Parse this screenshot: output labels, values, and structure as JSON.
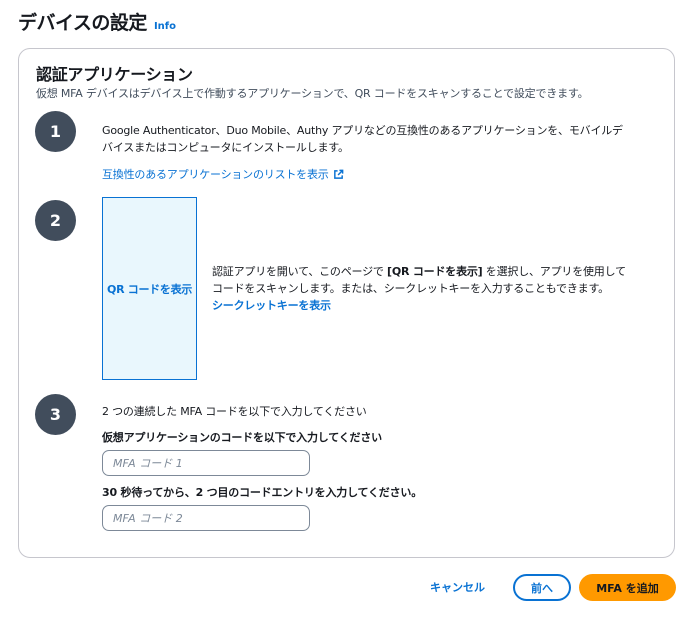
{
  "header": {
    "title": "デバイスの設定",
    "info": "Info"
  },
  "section": {
    "title": "認証アプリケーション",
    "description": "仮想 MFA デバイスはデバイス上で作動するアプリケーションで、QR コードをスキャンすることで設定できます。"
  },
  "step1": {
    "number": "1",
    "line1": "Google Authenticator、Duo Mobile、Authy アプリなどの互換性のあるアプリケーションを、モバイルデ",
    "line2": "バイスまたはコンピュータにインストールします。",
    "link": "互換性のあるアプリケーションのリストを表示"
  },
  "step2": {
    "number": "2",
    "qr_button": "QR コードを表示",
    "text_a": "認証アプリを開いて、このページで ",
    "text_b": "[QR コードを表示]",
    "text_c": " を選択し、アプリを使用して",
    "line2": "コードをスキャンします。または、シークレットキーを入力することもできます。",
    "secret_link": "シークレットキーを表示"
  },
  "step3": {
    "number": "3",
    "intro": "2 つの連続した MFA コードを以下で入力してください",
    "label1": "仮想アプリケーションのコードを以下で入力してください",
    "placeholder1": "MFA コード 1",
    "label2": "30 秒待ってから、2 つ目のコードエントリを入力してください。",
    "placeholder2": "MFA コード 2"
  },
  "footer": {
    "cancel": "キャンセル",
    "previous": "前へ",
    "submit": "MFA を追加"
  },
  "colors": {
    "accent": "#0972d3",
    "primary_button": "#ff9900",
    "step_circle": "#414d5c"
  }
}
